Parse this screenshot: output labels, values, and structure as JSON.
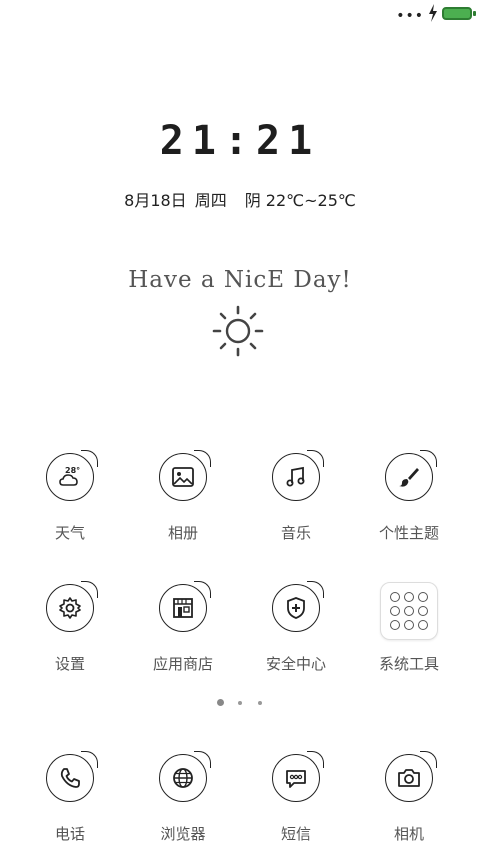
{
  "status_bar": {
    "signal_text": "•••",
    "charging_icon": "bolt-icon",
    "battery_color": "#4caf50"
  },
  "clock": {
    "time": "21:21",
    "date": "8月18日",
    "weekday": "周四",
    "weather": "阴 22℃~25℃"
  },
  "motto": {
    "text": "Have a NicE Day!",
    "icon": "sun-doodle"
  },
  "apps": {
    "weather": {
      "label": "天气",
      "badge": "28°",
      "icon": "weather-icon"
    },
    "gallery": {
      "label": "相册",
      "icon": "image-icon"
    },
    "music": {
      "label": "音乐",
      "icon": "music-note-icon"
    },
    "themes": {
      "label": "个性主题",
      "icon": "paint-brush-icon"
    },
    "settings": {
      "label": "设置",
      "icon": "gear-icon"
    },
    "app_store": {
      "label": "应用商店",
      "icon": "store-icon"
    },
    "security": {
      "label": "安全中心",
      "icon": "shield-icon"
    },
    "system_tools": {
      "label": "系统工具",
      "icon": "folder-icon"
    },
    "phone": {
      "label": "电话",
      "icon": "phone-icon"
    },
    "browser": {
      "label": "浏览器",
      "icon": "globe-icon"
    },
    "messages": {
      "label": "短信",
      "icon": "message-icon"
    },
    "camera": {
      "label": "相机",
      "icon": "camera-icon"
    }
  },
  "page_indicator": {
    "pages": 3,
    "active": 1
  }
}
